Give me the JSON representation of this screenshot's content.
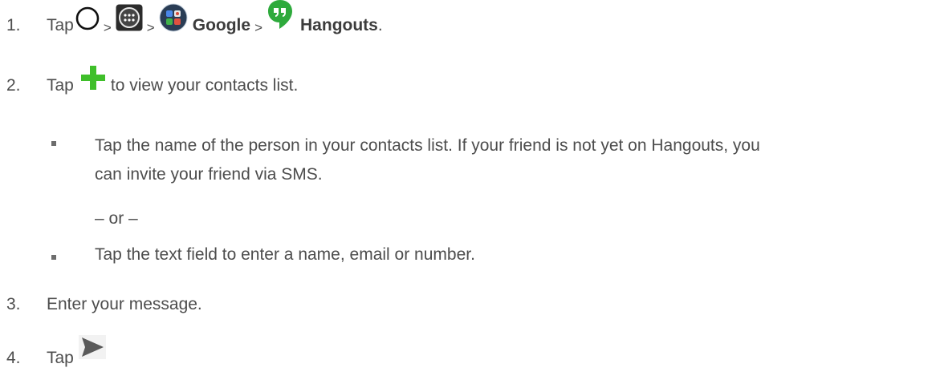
{
  "steps": [
    {
      "number": "1.",
      "tap": "Tap",
      "sep": ">",
      "google_label": "Google",
      "hangouts_label": "Hangouts",
      "period": "."
    },
    {
      "number": "2.",
      "tap": "Tap",
      "after_icon": "to view your contacts list.",
      "bullets": [
        {
          "line1": "Tap the name of the person in your contacts list. If your friend is not yet on Hangouts, you",
          "line2": "can invite your friend via SMS."
        },
        {
          "line1": "Tap the text field to enter a name, email or number."
        }
      ],
      "or_text": "– or –"
    },
    {
      "number": "3.",
      "text": "Enter your message."
    },
    {
      "number": "4.",
      "tap": "Tap"
    }
  ],
  "icons": {
    "home": "home-circle-icon",
    "apps": "apps-grid-icon",
    "google": "google-folder-icon",
    "hangouts": "hangouts-icon",
    "add": "add-plus-icon",
    "send": "send-arrow-icon"
  },
  "colors": {
    "text": "#4d4d4d",
    "plus_green": "#3fbf2a",
    "hangouts_green": "#2eaa3c"
  }
}
